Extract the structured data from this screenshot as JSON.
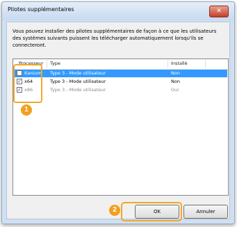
{
  "dialog": {
    "title": "Pilotes supplémentaires",
    "close_glyph": "✕",
    "description": "Vous pouvez installer des pilotes supplémentaires de façon à ce que les utilisateurs des systèmes suivants puissent les télécharger automatiquement lorsqu'ils se connecteront."
  },
  "table": {
    "columns": [
      "Processeur",
      "Type",
      "Installé"
    ],
    "rows": [
      {
        "processor": "Itanium",
        "type": "Type 3 - Mode utilisateur",
        "installed": "Non",
        "checked": false,
        "selected": true
      },
      {
        "processor": "x64",
        "type": "Type 3 - Mode utilisateur",
        "installed": "Non",
        "checked": true,
        "selected": false
      },
      {
        "processor": "x86",
        "type": "Type 3 - Mode utilisateur",
        "installed": "Oui",
        "checked": true,
        "selected": false
      }
    ]
  },
  "buttons": {
    "ok": "OK",
    "cancel": "Annuler"
  },
  "callouts": {
    "one": "1",
    "two": "2"
  },
  "colors": {
    "selection": "#3399ff",
    "callout": "#f5a623"
  }
}
